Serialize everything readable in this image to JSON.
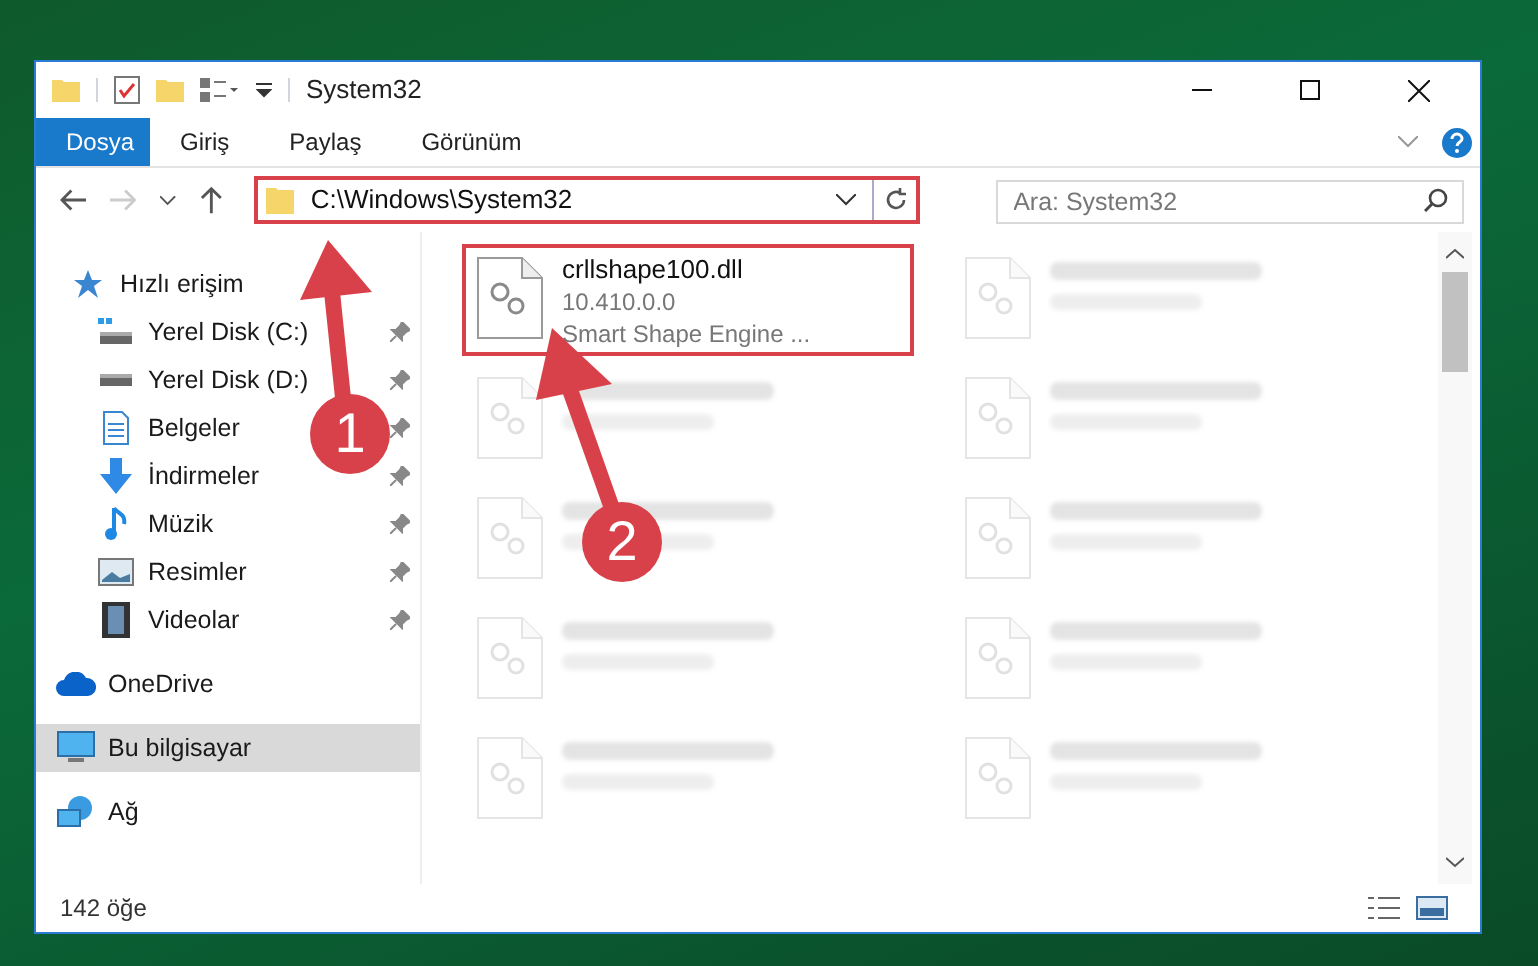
{
  "window": {
    "title": "System32"
  },
  "ribbon_tabs": [
    {
      "label": "Dosya",
      "selected": true
    },
    {
      "label": "Giriş",
      "selected": false
    },
    {
      "label": "Paylaş",
      "selected": false
    },
    {
      "label": "Görünüm",
      "selected": false
    }
  ],
  "address_bar": {
    "path": "C:\\Windows\\System32"
  },
  "search": {
    "placeholder": "Ara: System32"
  },
  "sidebar": {
    "items": [
      {
        "label": "Hızlı erişim",
        "selected": false,
        "children": [
          {
            "label": "Yerel Disk (C:)",
            "pinned": true,
            "selected": false
          },
          {
            "label": "Yerel Disk (D:)",
            "pinned": true,
            "selected": false
          },
          {
            "label": "Belgeler",
            "pinned": true,
            "selected": false
          },
          {
            "label": "İndirmeler",
            "pinned": true,
            "selected": false
          },
          {
            "label": "Müzik",
            "pinned": true,
            "selected": false
          },
          {
            "label": "Resimler",
            "pinned": true,
            "selected": false
          },
          {
            "label": "Videolar",
            "pinned": true,
            "selected": false
          }
        ]
      },
      {
        "label": "OneDrive",
        "selected": false
      },
      {
        "label": "Bu bilgisayar",
        "selected": true
      },
      {
        "label": "Ağ",
        "selected": false
      }
    ]
  },
  "files": [
    {
      "kind": "file",
      "name": "crllshape100.dll",
      "version": "10.410.0.0",
      "description": "Smart Shape Engine ...",
      "highlighted": true
    },
    {
      "kind": "blurred"
    },
    {
      "kind": "blurred"
    },
    {
      "kind": "blurred"
    },
    {
      "kind": "blurred"
    },
    {
      "kind": "blurred"
    },
    {
      "kind": "blurred"
    },
    {
      "kind": "blurred"
    },
    {
      "kind": "blurred"
    },
    {
      "kind": "blurred"
    }
  ],
  "status_bar": {
    "count": "142 öğe"
  },
  "annotations": [
    {
      "number": "1"
    },
    {
      "number": "2"
    }
  ]
}
